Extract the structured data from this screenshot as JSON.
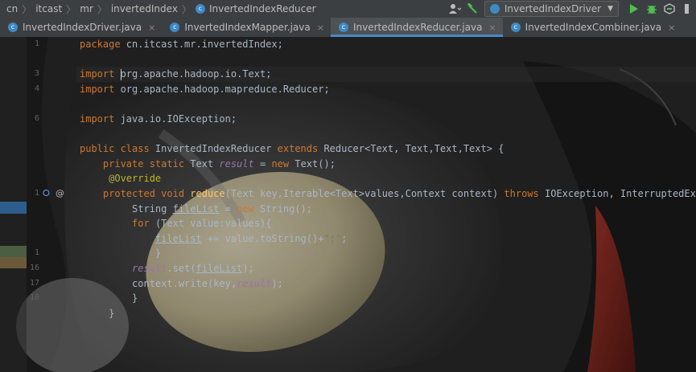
{
  "breadcrumbs": [
    "cn",
    "itcast",
    "mr",
    "invertedIndex",
    "InvertedIndexReducer"
  ],
  "run_config": "InvertedIndexDriver",
  "tabs": [
    {
      "label": "InvertedIndexDriver.java",
      "icon": "c",
      "active": false
    },
    {
      "label": "InvertedIndexMapper.java",
      "icon": "c",
      "active": false
    },
    {
      "label": "InvertedIndexReducer.java",
      "icon": "c",
      "active": true
    },
    {
      "label": "InvertedIndexCombiner.java",
      "icon": "c",
      "active": false
    }
  ],
  "tab_close_glyph": "×",
  "gutter": {
    "line_numbers": [
      "1",
      "",
      "3",
      "4",
      "",
      "6",
      "",
      "",
      "",
      "",
      "1",
      "",
      "",
      "",
      "1",
      "16",
      "17",
      "18",
      ""
    ]
  },
  "code_lines": [
    [
      {
        "t": "package ",
        "c": "kw"
      },
      {
        "t": "cn.itcast.mr.invertedIndex;",
        "c": ""
      }
    ],
    [],
    [
      {
        "t": "import ",
        "c": "kw"
      },
      {
        "t": "CARET",
        "c": "caret"
      },
      {
        "t": "org.apache.hadoop.io.Text;",
        "c": ""
      }
    ],
    [
      {
        "t": "import ",
        "c": "kw"
      },
      {
        "t": "org.apache.hadoop.mapreduce.Reducer;",
        "c": ""
      }
    ],
    [],
    [
      {
        "t": "import ",
        "c": "kw"
      },
      {
        "t": "java.io.IOException;",
        "c": ""
      }
    ],
    [],
    [
      {
        "t": "public class ",
        "c": "kw"
      },
      {
        "t": "InvertedIndexReducer ",
        "c": ""
      },
      {
        "t": "extends ",
        "c": "kw"
      },
      {
        "t": "Reducer<Text, Text,Text,Text> {",
        "c": ""
      }
    ],
    [
      {
        "t": "    private static ",
        "c": "kw"
      },
      {
        "t": "Text ",
        "c": ""
      },
      {
        "t": "result",
        "c": "fld"
      },
      {
        "t": " = ",
        "c": ""
      },
      {
        "t": "new ",
        "c": "kw"
      },
      {
        "t": "Text();",
        "c": ""
      }
    ],
    [
      {
        "t": "     ",
        "c": ""
      },
      {
        "t": "@Override",
        "c": "ann"
      }
    ],
    [
      {
        "t": "    protected void ",
        "c": "kw"
      },
      {
        "t": "reduce",
        "c": "fn"
      },
      {
        "t": "(Text key,Iterable<Text>values,Context context) ",
        "c": ""
      },
      {
        "t": "throws ",
        "c": "kw"
      },
      {
        "t": "IOException, InterruptedException {",
        "c": ""
      }
    ],
    [
      {
        "t": "         String ",
        "c": ""
      },
      {
        "t": "fileList",
        "c": "var"
      },
      {
        "t": " = ",
        "c": ""
      },
      {
        "t": "new ",
        "c": "kw"
      },
      {
        "t": "String();",
        "c": ""
      }
    ],
    [
      {
        "t": "         ",
        "c": ""
      },
      {
        "t": "for ",
        "c": "kw"
      },
      {
        "t": "(Text value:values){",
        "c": ""
      }
    ],
    [
      {
        "t": "             ",
        "c": ""
      },
      {
        "t": "fileList",
        "c": "var"
      },
      {
        "t": " += value.toString()+",
        "c": ""
      },
      {
        "t": "\";\"",
        "c": "str"
      },
      {
        "t": ";",
        "c": ""
      }
    ],
    [
      {
        "t": "             }",
        "c": ""
      }
    ],
    [
      {
        "t": "         ",
        "c": ""
      },
      {
        "t": "result",
        "c": "fld"
      },
      {
        "t": ".set(",
        "c": ""
      },
      {
        "t": "fileList",
        "c": "var"
      },
      {
        "t": ");",
        "c": ""
      }
    ],
    [
      {
        "t": "         context.write(key,",
        "c": ""
      },
      {
        "t": "result",
        "c": "fld"
      },
      {
        "t": ");",
        "c": ""
      }
    ],
    [
      {
        "t": "         }",
        "c": ""
      }
    ],
    [
      {
        "t": "     }",
        "c": ""
      }
    ]
  ],
  "icons": {
    "class": "c-class-icon",
    "user": "user-icon",
    "build": "hammer-icon",
    "run": "run-icon",
    "debug": "debug-icon",
    "coverage": "coverage-icon",
    "more": "more-icon"
  },
  "colors": {
    "keyword": "#cc7832",
    "annotation": "#bbb529",
    "field": "#9876aa",
    "method": "#ffc66d",
    "string": "#6a8759",
    "text": "#a9b7c6",
    "active_tab_underline": "#4a88c7",
    "run_green": "#4fbe4f"
  }
}
